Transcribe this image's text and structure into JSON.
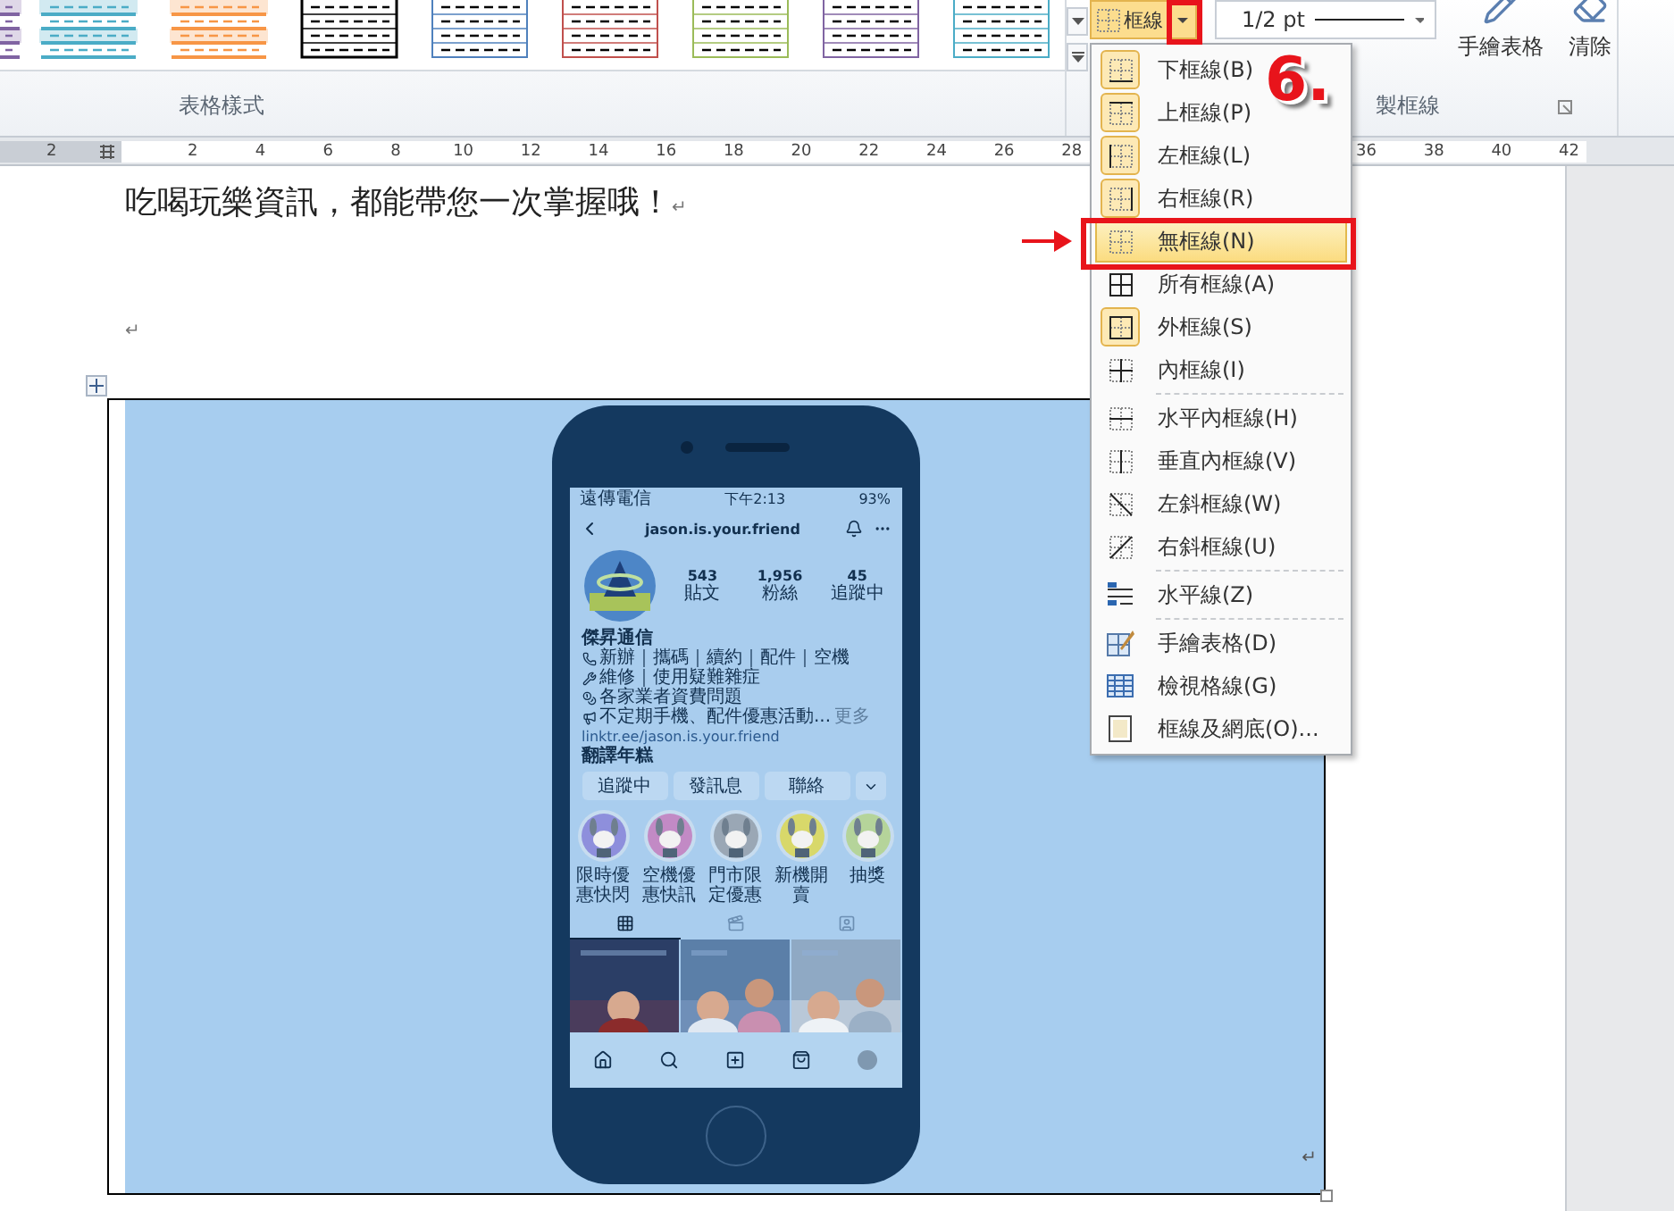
{
  "ribbon": {
    "table_styles": [
      {
        "kind": "shaded",
        "color": "#8064a2"
      },
      {
        "kind": "shaded",
        "color": "#4bacc6"
      },
      {
        "kind": "shaded",
        "color": "#f79646"
      },
      {
        "kind": "outlined",
        "color": "#000000"
      },
      {
        "kind": "outlined",
        "color": "#4f81bd"
      },
      {
        "kind": "outlined",
        "color": "#c0504d"
      },
      {
        "kind": "outlined",
        "color": "#9bbb59"
      },
      {
        "kind": "outlined",
        "color": "#8064a2"
      },
      {
        "kind": "outlined",
        "color": "#4bacc6"
      }
    ],
    "styles_group_label": "表格樣式",
    "borders_button": {
      "label": "框線",
      "pressed": true
    },
    "line_weight": {
      "value": "1/2 pt"
    },
    "draw_table_label": "手繪表格",
    "eraser_label": "清除",
    "draw_group_label": "製框線"
  },
  "ruler": {
    "left_numbers": [
      "2"
    ],
    "numbers": [
      "2",
      "4",
      "6",
      "8",
      "10",
      "12",
      "14",
      "16",
      "18",
      "20",
      "22",
      "24",
      "26",
      "28"
    ],
    "right_numbers": [
      "36",
      "38",
      "40",
      "42"
    ]
  },
  "border_menu": {
    "items": [
      {
        "label": "下框線(B)",
        "active": true,
        "selected": false,
        "separator_after": false
      },
      {
        "label": "上框線(P)",
        "active": true,
        "selected": false,
        "separator_after": false
      },
      {
        "label": "左框線(L)",
        "active": true,
        "selected": false,
        "separator_after": false
      },
      {
        "label": "右框線(R)",
        "active": true,
        "selected": false,
        "separator_after": false
      },
      {
        "label": "無框線(N)",
        "active": false,
        "selected": true,
        "separator_after": false
      },
      {
        "label": "所有框線(A)",
        "active": false,
        "selected": false,
        "separator_after": false
      },
      {
        "label": "外框線(S)",
        "active": true,
        "selected": false,
        "separator_after": false
      },
      {
        "label": "內框線(I)",
        "active": false,
        "selected": false,
        "separator_after": true
      },
      {
        "label": "水平內框線(H)",
        "active": false,
        "selected": false,
        "separator_after": false
      },
      {
        "label": "垂直內框線(V)",
        "active": false,
        "selected": false,
        "separator_after": false
      },
      {
        "label": "左斜框線(W)",
        "active": false,
        "selected": false,
        "separator_after": false
      },
      {
        "label": "右斜框線(U)",
        "active": false,
        "selected": false,
        "separator_after": true
      },
      {
        "label": "水平線(Z)",
        "active": false,
        "selected": false,
        "separator_after": true
      },
      {
        "label": "手繪表格(D)",
        "active": false,
        "selected": false,
        "separator_after": false
      },
      {
        "label": "檢視格線(G)",
        "active": false,
        "selected": false,
        "separator_after": false
      },
      {
        "label": "框線及網底(O)...",
        "active": false,
        "selected": false,
        "separator_after": false
      }
    ]
  },
  "annotation": {
    "step": "6."
  },
  "document": {
    "paragraphs": [
      {
        "text": "吃喝玩樂資訊，都能帶您一次掌握哦！",
        "mark": "↵"
      },
      {
        "mark": "↵"
      }
    ],
    "cell_end_mark": "↵"
  },
  "phone": {
    "status": {
      "carrier": "遠傳電信",
      "time": "下午2:13",
      "battery": "93%"
    },
    "username": "jason.is.your.friend",
    "stats": [
      {
        "value": "543",
        "label": "貼文"
      },
      {
        "value": "1,956",
        "label": "粉絲"
      },
      {
        "value": "45",
        "label": "追蹤中"
      }
    ],
    "bio": [
      {
        "kind": "name",
        "text": "傑昇通信"
      },
      {
        "kind": "feature",
        "text": "新辦｜攜碼｜續約｜配件｜空機"
      },
      {
        "kind": "feature",
        "text": "維修｜使用疑難雜症"
      },
      {
        "kind": "feature",
        "text": "各家業者資費問題"
      },
      {
        "kind": "feature",
        "text": "不定期手機、配件優惠活動...",
        "more": "更多"
      },
      {
        "kind": "link",
        "text": "linktr.ee/jason.is.your.friend"
      },
      {
        "kind": "name",
        "text": "翻譯年糕"
      }
    ],
    "actions": [
      "追蹤中",
      "發訊息",
      "聯絡"
    ],
    "highlights": [
      "限時優惠快閃",
      "空機優惠快訊",
      "門市限定優惠",
      "新機開賣",
      "抽獎"
    ],
    "profile_tabs": [
      {
        "selected": true
      },
      {
        "selected": false
      },
      {
        "selected": false
      }
    ]
  }
}
